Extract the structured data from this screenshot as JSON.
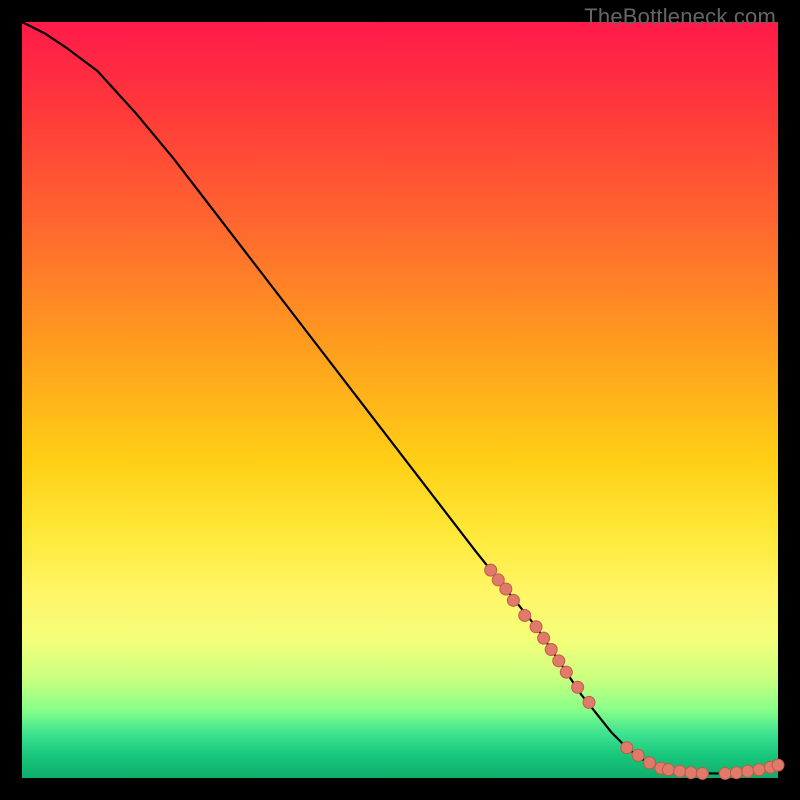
{
  "watermark": "TheBottleneck.com",
  "colors": {
    "curve": "#000000",
    "marker_fill": "#e07a6a",
    "marker_stroke": "#c25a4a",
    "frame": "#000000"
  },
  "chart_data": {
    "type": "line",
    "title": "",
    "xlabel": "",
    "ylabel": "",
    "xlim": [
      0,
      100
    ],
    "ylim": [
      0,
      100
    ],
    "grid": false,
    "legend": false,
    "series": [
      {
        "name": "curve",
        "x": [
          0,
          3,
          6,
          10,
          15,
          20,
          25,
          30,
          35,
          40,
          45,
          50,
          55,
          60,
          62,
          64,
          66,
          68,
          70,
          72,
          74,
          76,
          78,
          80,
          82,
          84,
          86,
          88,
          90,
          92,
          94,
          96,
          98,
          100
        ],
        "y": [
          100,
          98.5,
          96.5,
          93.5,
          88,
          82,
          75.5,
          69,
          62.5,
          56,
          49.5,
          43,
          36.5,
          30,
          27.5,
          25,
          22.5,
          20,
          17,
          14,
          11,
          8.5,
          6,
          4,
          2.5,
          1.5,
          1,
          0.7,
          0.6,
          0.6,
          0.7,
          0.9,
          1.2,
          1.7
        ]
      }
    ],
    "markers": [
      {
        "x": 62,
        "y": 27.5
      },
      {
        "x": 63,
        "y": 26.2
      },
      {
        "x": 64,
        "y": 25
      },
      {
        "x": 65,
        "y": 23.5
      },
      {
        "x": 66.5,
        "y": 21.5
      },
      {
        "x": 68,
        "y": 20
      },
      {
        "x": 69,
        "y": 18.5
      },
      {
        "x": 70,
        "y": 17
      },
      {
        "x": 71,
        "y": 15.5
      },
      {
        "x": 72,
        "y": 14
      },
      {
        "x": 73.5,
        "y": 12
      },
      {
        "x": 75,
        "y": 10
      },
      {
        "x": 80,
        "y": 4
      },
      {
        "x": 81.5,
        "y": 3
      },
      {
        "x": 83,
        "y": 2
      },
      {
        "x": 84.5,
        "y": 1.3
      },
      {
        "x": 85.5,
        "y": 1.1
      },
      {
        "x": 87,
        "y": 0.9
      },
      {
        "x": 88.5,
        "y": 0.7
      },
      {
        "x": 90,
        "y": 0.6
      },
      {
        "x": 93,
        "y": 0.6
      },
      {
        "x": 94.5,
        "y": 0.7
      },
      {
        "x": 96,
        "y": 0.9
      },
      {
        "x": 97.5,
        "y": 1.1
      },
      {
        "x": 99,
        "y": 1.4
      },
      {
        "x": 100,
        "y": 1.7
      }
    ]
  }
}
